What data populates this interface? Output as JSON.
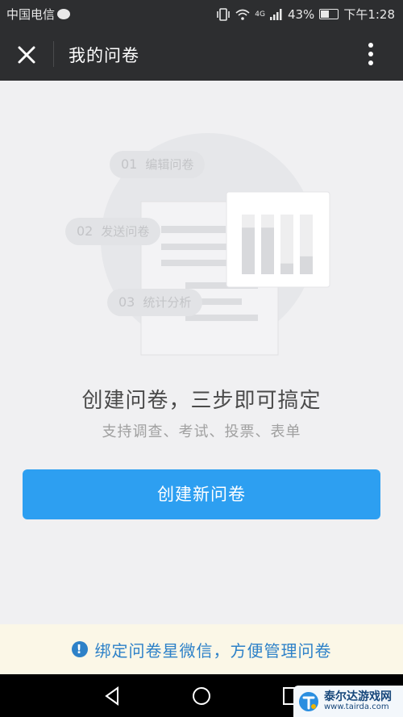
{
  "status_bar": {
    "carrier": "中国电信",
    "battery_percent": "43%",
    "time": "下午1:28",
    "network_label": "4G"
  },
  "nav": {
    "title": "我的问卷"
  },
  "steps": [
    {
      "num": "01",
      "label": "编辑问卷"
    },
    {
      "num": "02",
      "label": "发送问卷"
    },
    {
      "num": "03",
      "label": "统计分析"
    }
  ],
  "headline": "创建问卷，三步即可搞定",
  "subline": "支持调查、考试、投票、表单",
  "create_button": "创建新问卷",
  "bind_banner": "绑定问卷星微信，方便管理问卷",
  "watermark": {
    "name": "泰尔达游戏网",
    "url": "www.tairda.com"
  },
  "colors": {
    "header_bg": "#2d2e30",
    "accent": "#2d9ff1",
    "banner_text": "#2d81c8",
    "banner_bg": "#fbf7e7"
  },
  "illustration_bar_levels": [
    0.78,
    0.78,
    0.18,
    0.3
  ]
}
